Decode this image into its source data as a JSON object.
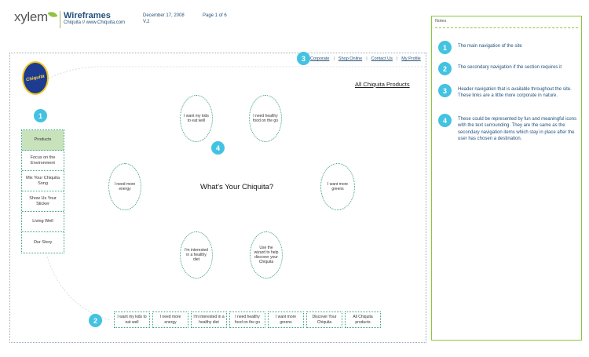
{
  "header": {
    "brand": "xylem",
    "title": "Wireframes",
    "subtitle": "Chiquita // www.Chiquita.com",
    "date": "December 17, 2008",
    "version": "V.2",
    "page": "Page 1 of 6"
  },
  "brand_logo_text": "Chiquita",
  "top_nav": [
    "Corporate",
    "Shop Online",
    "Contact Us",
    "My Profile"
  ],
  "all_products": "All Chiquita Products",
  "side_nav": [
    "Products",
    "Focus on the Environment",
    "Mix Your Chiquita Song",
    "Show Us Your Sticker",
    "Living Well",
    "Our Story"
  ],
  "center_question": "What's Your Chiquita?",
  "bubbles": {
    "kids": "I want my kids to eat well",
    "healthy_food": "I need healthy food on the go",
    "energy": "I need more energy",
    "greens": "I want more greens",
    "healthy_diet": "I'm interested in a healthy diet",
    "wizard": "Use the wizard to help discover your Chiquita"
  },
  "bottom_nav": [
    "I want my kids to eat well",
    "I need more energy",
    "I'm interested in a healthy diet",
    "I need healthy food on the go",
    "I want more greens",
    "Discover Your Chiquita",
    "All Chiquita products"
  ],
  "markers": [
    "1",
    "2",
    "3",
    "4"
  ],
  "notes": {
    "title": "Notes",
    "items": [
      {
        "num": "1",
        "text": "The main navigation of the site"
      },
      {
        "num": "2",
        "text": "The secondary navigation if the section requires it"
      },
      {
        "num": "3",
        "text": "Header navigation that is available throughout the site. These links are a little more corporate in nature."
      },
      {
        "num": "4",
        "text": "These could be represented by fun and meaningful icons with the text surrounding. They are the same as the secondary navigation items which stay in place after the user has chosen a destination."
      }
    ]
  },
  "colors": {
    "accent_marker": "#43c2e2",
    "wire_border": "#3a9f88",
    "notes_border": "#8cc63f",
    "active_nav": "#c8e3bc"
  }
}
